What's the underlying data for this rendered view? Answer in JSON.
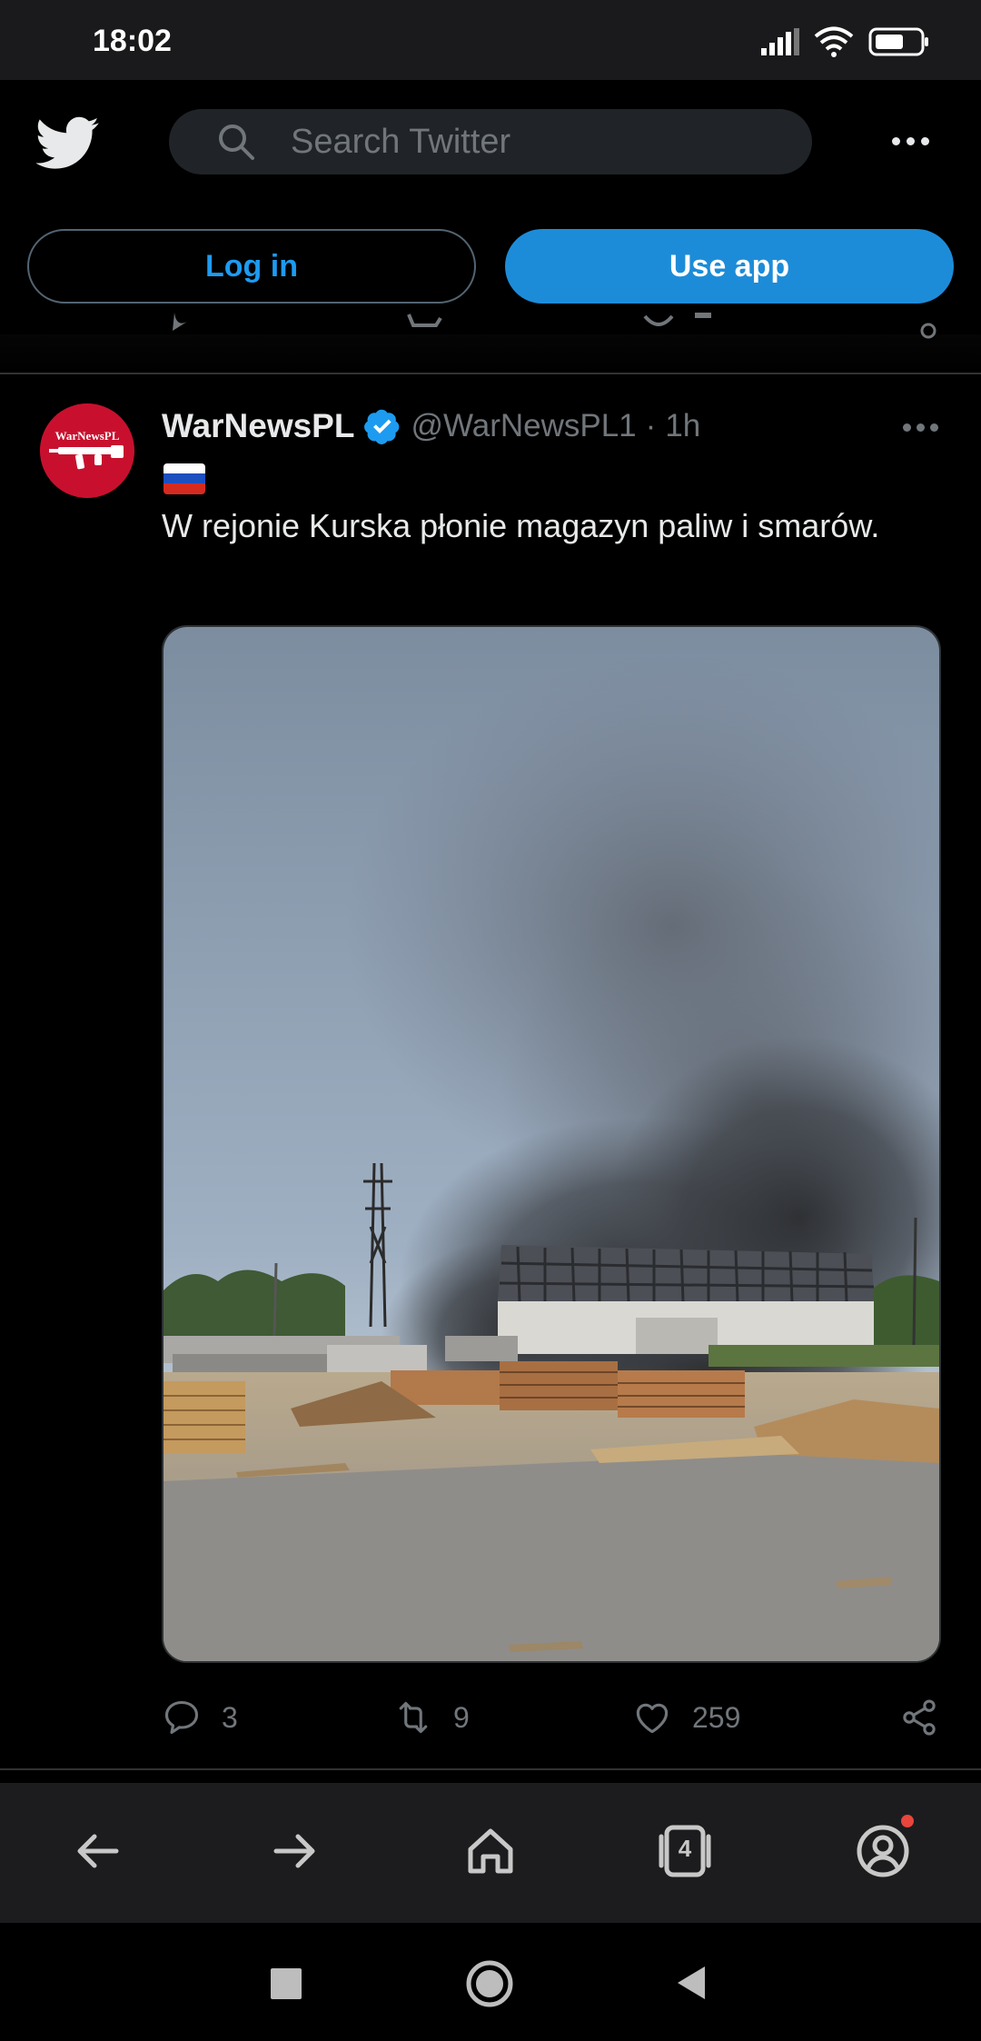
{
  "status_bar": {
    "time": "18:02",
    "icons": [
      "signal-icon",
      "wifi-icon",
      "battery-icon"
    ]
  },
  "header": {
    "logo": "twitter-bird-icon",
    "search_placeholder": "Search Twitter",
    "login_label": "Log in",
    "use_app_label": "Use app"
  },
  "tweet": {
    "author_name": "WarNewsPL",
    "verified": true,
    "handle": "@WarNewsPL1",
    "separator": "·",
    "time": "1h",
    "avatar_text": "WarNewsPL",
    "flag": "russian-flag",
    "text": "W rejonie Kurska płonie magazyn paliw i smarów.",
    "image": "photo of black smoke rising over a lumber yard with a damaged warehouse",
    "replies": "3",
    "retweets": "9",
    "likes": "259"
  },
  "browser_nav": {
    "tab_count": "4",
    "items": [
      "back-icon",
      "forward-icon",
      "home-icon",
      "tabs-icon",
      "profile-icon"
    ]
  },
  "colors": {
    "accent": "#1d9bf0",
    "button_fill": "#1d8cd8",
    "background": "#000000",
    "muted_text": "#71767b",
    "notification_dot": "#e8453c"
  }
}
